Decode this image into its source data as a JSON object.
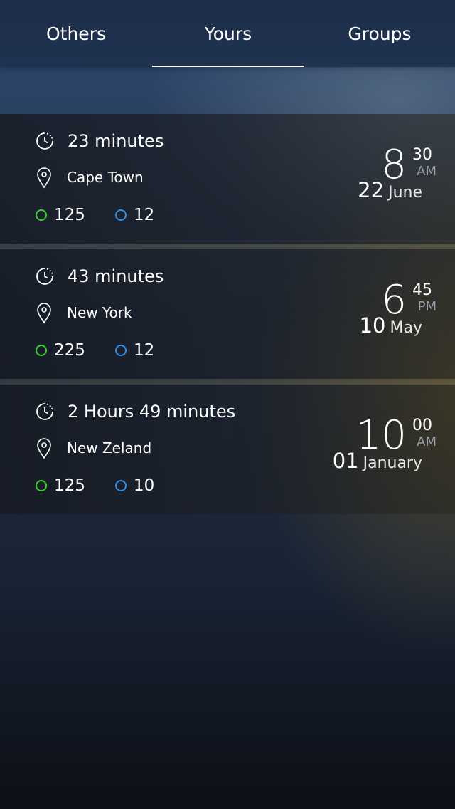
{
  "tabs": [
    {
      "label": "Others"
    },
    {
      "label": "Yours"
    },
    {
      "label": "Groups"
    }
  ],
  "active_tab": "Yours",
  "colors": {
    "green_stat": "#34d12f",
    "blue_stat": "#2b8fe8",
    "accent_underline": "#ffffff",
    "ampm_text": "#9aa0a8"
  },
  "icons": {
    "duration": "clock-icon",
    "location": "location-pin-icon",
    "green_stat": "green-circle-icon",
    "blue_stat": "blue-circle-icon"
  },
  "events": [
    {
      "duration": "23 minutes",
      "location": "Cape Town",
      "green_count": "125",
      "blue_count": "12",
      "hour": "8",
      "minute": "30",
      "ampm": "AM",
      "day": "22",
      "month": "June"
    },
    {
      "duration": "43 minutes",
      "location": "New York",
      "green_count": "225",
      "blue_count": "12",
      "hour": "6",
      "minute": "45",
      "ampm": "PM",
      "day": "10",
      "month": "May"
    },
    {
      "duration": "2 Hours 49 minutes",
      "location": "New Zeland",
      "green_count": "125",
      "blue_count": "10",
      "hour": "10",
      "minute": "00",
      "ampm": "AM",
      "day": "01",
      "month": "January"
    }
  ]
}
